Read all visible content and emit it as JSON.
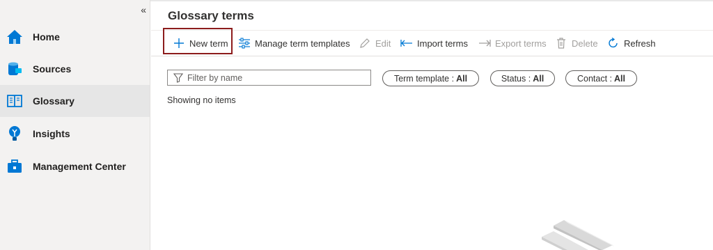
{
  "sidebar": {
    "collapse_glyph": "«",
    "items": [
      {
        "label": "Home",
        "icon": "home-icon",
        "active": false
      },
      {
        "label": "Sources",
        "icon": "sources-icon",
        "active": false
      },
      {
        "label": "Glossary",
        "icon": "glossary-icon",
        "active": true
      },
      {
        "label": "Insights",
        "icon": "insights-icon",
        "active": false
      },
      {
        "label": "Management Center",
        "icon": "management-center-icon",
        "active": false
      }
    ]
  },
  "page": {
    "title": "Glossary terms"
  },
  "toolbar": {
    "new_term": "New term",
    "manage_templates": "Manage term templates",
    "edit": "Edit",
    "import_terms": "Import terms",
    "export_terms": "Export terms",
    "delete": "Delete",
    "refresh": "Refresh"
  },
  "filters": {
    "search_placeholder": "Filter by name",
    "term_template": {
      "label": "Term template :",
      "value": "All"
    },
    "status": {
      "label": "Status :",
      "value": "All"
    },
    "contact": {
      "label": "Contact :",
      "value": "All"
    }
  },
  "list": {
    "status_text": "Showing no items"
  },
  "colors": {
    "accent": "#0078d4",
    "highlight_border": "#8c1c1c",
    "sidebar_bg": "#f3f2f1",
    "active_item_bg": "#e6e6e6"
  }
}
